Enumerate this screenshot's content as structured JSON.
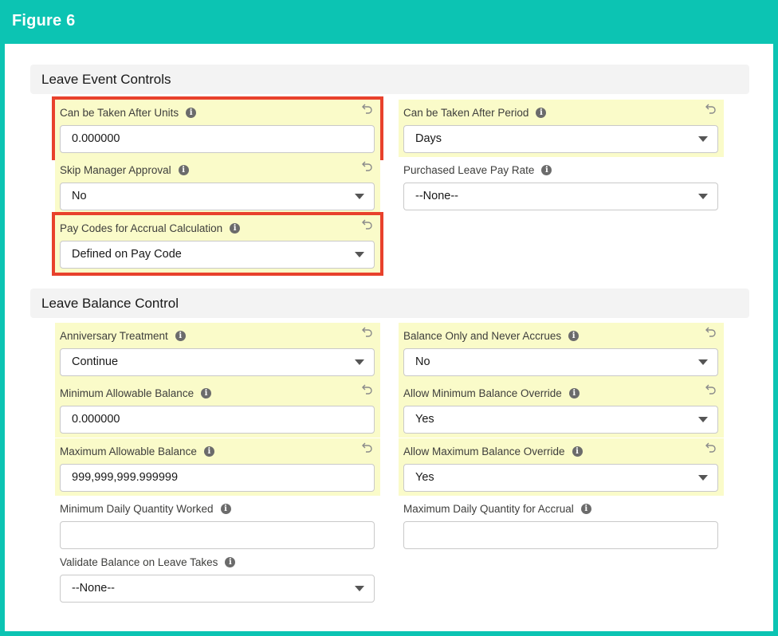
{
  "figure_title": "Figure 6",
  "sections": {
    "leave_event": {
      "title": "Leave Event Controls"
    },
    "leave_balance": {
      "title": "Leave Balance Control"
    }
  },
  "fields": {
    "can_be_taken_after_units": {
      "label": "Can be Taken After Units",
      "value": "0.000000"
    },
    "can_be_taken_after_period": {
      "label": "Can be Taken After Period",
      "value": "Days"
    },
    "skip_manager_approval": {
      "label": "Skip Manager Approval",
      "value": "No"
    },
    "purchased_leave_pay_rate": {
      "label": "Purchased Leave Pay Rate",
      "value": "--None--"
    },
    "pay_codes_accrual": {
      "label": "Pay Codes for Accrual Calculation",
      "value": "Defined on Pay Code"
    },
    "anniversary_treatment": {
      "label": "Anniversary Treatment",
      "value": "Continue"
    },
    "balance_only_never_accrues": {
      "label": "Balance Only and Never Accrues",
      "value": "No"
    },
    "minimum_allowable_balance": {
      "label": "Minimum Allowable Balance",
      "value": "0.000000"
    },
    "allow_min_balance_override": {
      "label": "Allow Minimum Balance Override",
      "value": "Yes"
    },
    "maximum_allowable_balance": {
      "label": "Maximum Allowable Balance",
      "value": "999,999,999.999999"
    },
    "allow_max_balance_override": {
      "label": "Allow Maximum Balance Override",
      "value": "Yes"
    },
    "min_daily_quantity_worked": {
      "label": "Minimum Daily Quantity Worked",
      "value": ""
    },
    "max_daily_quantity_accrual": {
      "label": "Maximum Daily Quantity for Accrual",
      "value": ""
    },
    "validate_balance_leave_takes": {
      "label": "Validate Balance on Leave Takes",
      "value": "--None--"
    }
  },
  "info_glyph": "i",
  "colors": {
    "frame_teal": "#0cc4b3",
    "highlight_yellow": "#fafbc9",
    "annotation_red": "#e8412c",
    "section_bg": "#f3f3f3"
  },
  "icons": {
    "info": "info-icon",
    "undo": "undo-icon",
    "dropdown": "chevron-down-icon"
  }
}
